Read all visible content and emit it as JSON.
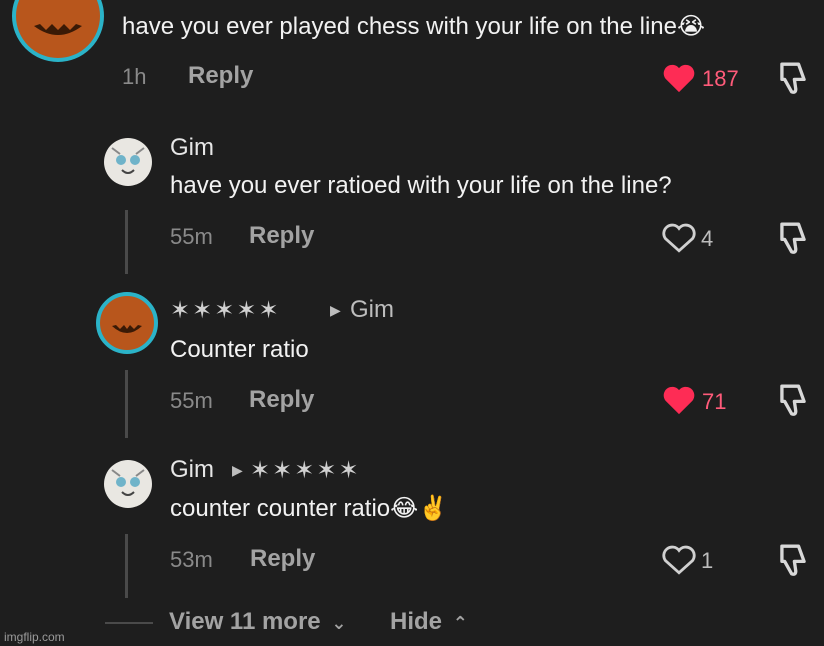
{
  "top_comment": {
    "text": "have you ever played chess with your life on the line😭",
    "time": "1h",
    "reply_label": "Reply",
    "like_count": "187",
    "liked": true
  },
  "replies": [
    {
      "author": "Gim",
      "text": "have you ever ratioed with your life on the line?",
      "time": "55m",
      "reply_label": "Reply",
      "like_count": "4",
      "liked": false
    },
    {
      "author": "✶✶✶✶✶",
      "reply_to": "Gim",
      "text": "Counter ratio",
      "time": "55m",
      "reply_label": "Reply",
      "like_count": "71",
      "liked": true
    },
    {
      "author": "Gim",
      "reply_to": "✶✶✶✶✶",
      "text": "counter counter ratio😂✌️",
      "time": "53m",
      "reply_label": "Reply",
      "like_count": "1",
      "liked": false
    }
  ],
  "footer": {
    "view_more": "View 11 more",
    "hide": "Hide"
  },
  "watermark": "imgflip.com",
  "colors": {
    "background": "#1e1e1e",
    "liked_heart": "#fe2c55",
    "liked_count": "#ff5b7a",
    "avatar_ring": "#2bb3c8",
    "pumpkin": "#b8561c"
  },
  "icons": [
    "pumpkin-avatar",
    "cat-avatar",
    "heart-icon",
    "dislike-icon",
    "chevron-down-icon",
    "chevron-up-icon",
    "reply-arrow-icon"
  ]
}
